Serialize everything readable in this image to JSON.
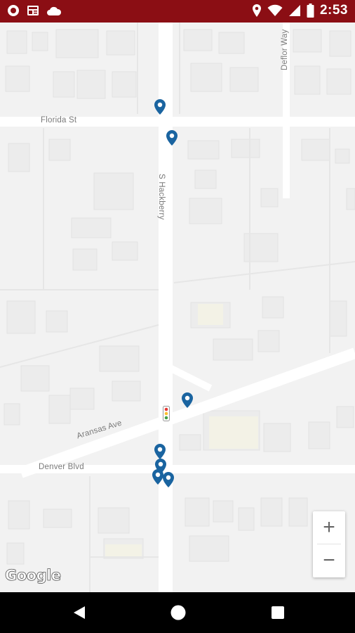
{
  "status_bar": {
    "time": "2:53",
    "left_icons": [
      "opera-icon",
      "news-icon",
      "cloud-icon"
    ],
    "right_icons": [
      "location-icon",
      "wifi-icon",
      "signal-icon",
      "battery-icon"
    ],
    "background_color": "#8b0e14"
  },
  "map": {
    "streets": {
      "florida": "Florida St",
      "hackberry": "S Hackberry",
      "deflor": "Deflor Way",
      "aransas": "Aransas Ave",
      "denver": "Denver Blvd"
    },
    "pin_color": "#1a64a0",
    "zoom_in_label": "+",
    "zoom_out_label": "−",
    "attribution": "Google"
  },
  "nav_bar": {
    "icons": [
      "back-icon",
      "home-icon",
      "recents-icon"
    ]
  }
}
